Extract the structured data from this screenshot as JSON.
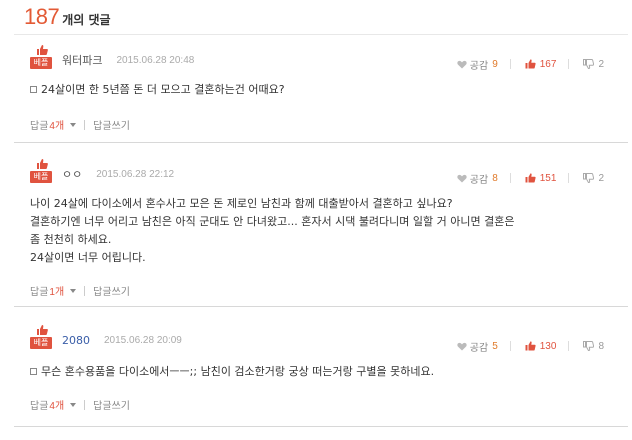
{
  "header": {
    "count": "187",
    "label": "개의 댓글"
  },
  "comments": [
    {
      "badge": "베플",
      "author": "워터파크",
      "date": "2015.06.28 20:48",
      "agree_label": "공감",
      "agree_count": "9",
      "like_count": "167",
      "dislike_count": "2",
      "lines": [
        "24살이면 한 5년쯤 돈 더 모으고 결혼하는건 어때요?"
      ],
      "reply_label": "답글",
      "reply_count": "4개",
      "write_reply": "답글쓰기"
    },
    {
      "badge": "베플",
      "author": "ㅇㅇ",
      "date": "2015.06.28 22:12",
      "agree_label": "공감",
      "agree_count": "8",
      "like_count": "151",
      "dislike_count": "2",
      "lines": [
        "나이 24살에 다이소에서 혼수사고 모은 돈 제로인 남친과 함께 대출받아서 결혼하고 싶나요?",
        "결혼하기엔 너무 어리고 남친은 아직 군대도 안 다녀왔고... 혼자서 시댁 불려다니며 일할 거 아니면 결혼은",
        "좀 천천히 하세요.",
        "24살이면 너무 어립니다."
      ],
      "reply_label": "답글",
      "reply_count": "1개",
      "write_reply": "답글쓰기"
    },
    {
      "badge": "베플",
      "author": "2080",
      "date": "2015.06.28 20:09",
      "agree_label": "공감",
      "agree_count": "5",
      "like_count": "130",
      "dislike_count": "8",
      "lines": [
        "무슨 혼수용품을 다이소에서ㅡㅡ;; 남친이 검소한거랑 궁상 떠는거랑 구별을 못하네요."
      ],
      "reply_label": "답글",
      "reply_count": "4개",
      "write_reply": "답글쓰기"
    }
  ],
  "colors": {
    "accent": "#e35a35",
    "badge": "#e0533f",
    "agree": "#e07a2a"
  }
}
